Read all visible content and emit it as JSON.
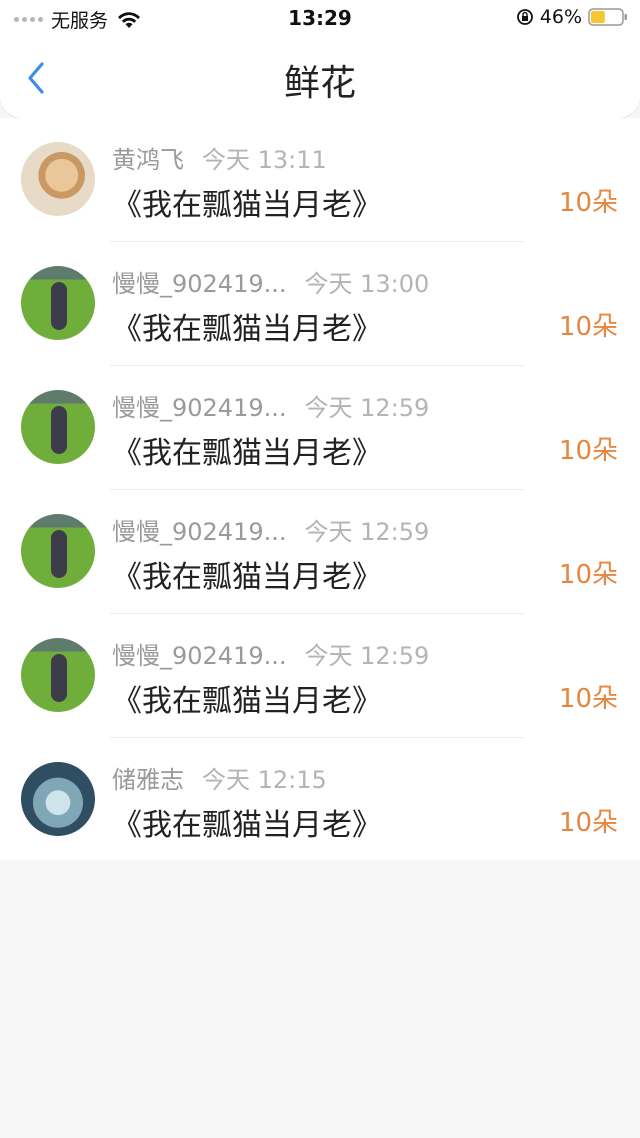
{
  "status_bar": {
    "carrier": "无服务",
    "time": "13:29",
    "battery_percent": "46%",
    "battery_level": 0.46,
    "battery_color": "#f5c631"
  },
  "nav": {
    "title": "鲜花",
    "back_icon": "chevron-left-icon",
    "accent": "#3a8ee6"
  },
  "records": [
    {
      "name": "黄鸿飞",
      "time": "今天 13:11",
      "title": "《我在瓢猫当月老》",
      "amount": "10朵",
      "avatar": "cat"
    },
    {
      "name": "慢慢_902419...",
      "time": "今天 13:00",
      "title": "《我在瓢猫当月老》",
      "amount": "10朵",
      "avatar": "kid"
    },
    {
      "name": "慢慢_902419...",
      "time": "今天 12:59",
      "title": "《我在瓢猫当月老》",
      "amount": "10朵",
      "avatar": "kid"
    },
    {
      "name": "慢慢_902419...",
      "time": "今天 12:59",
      "title": "《我在瓢猫当月老》",
      "amount": "10朵",
      "avatar": "kid"
    },
    {
      "name": "慢慢_902419...",
      "time": "今天 12:59",
      "title": "《我在瓢猫当月老》",
      "amount": "10朵",
      "avatar": "kid"
    },
    {
      "name": "储雅志",
      "time": "今天 12:15",
      "title": "《我在瓢猫当月老》",
      "amount": "10朵",
      "avatar": "water"
    }
  ],
  "colors": {
    "amount": "#e6863f"
  }
}
